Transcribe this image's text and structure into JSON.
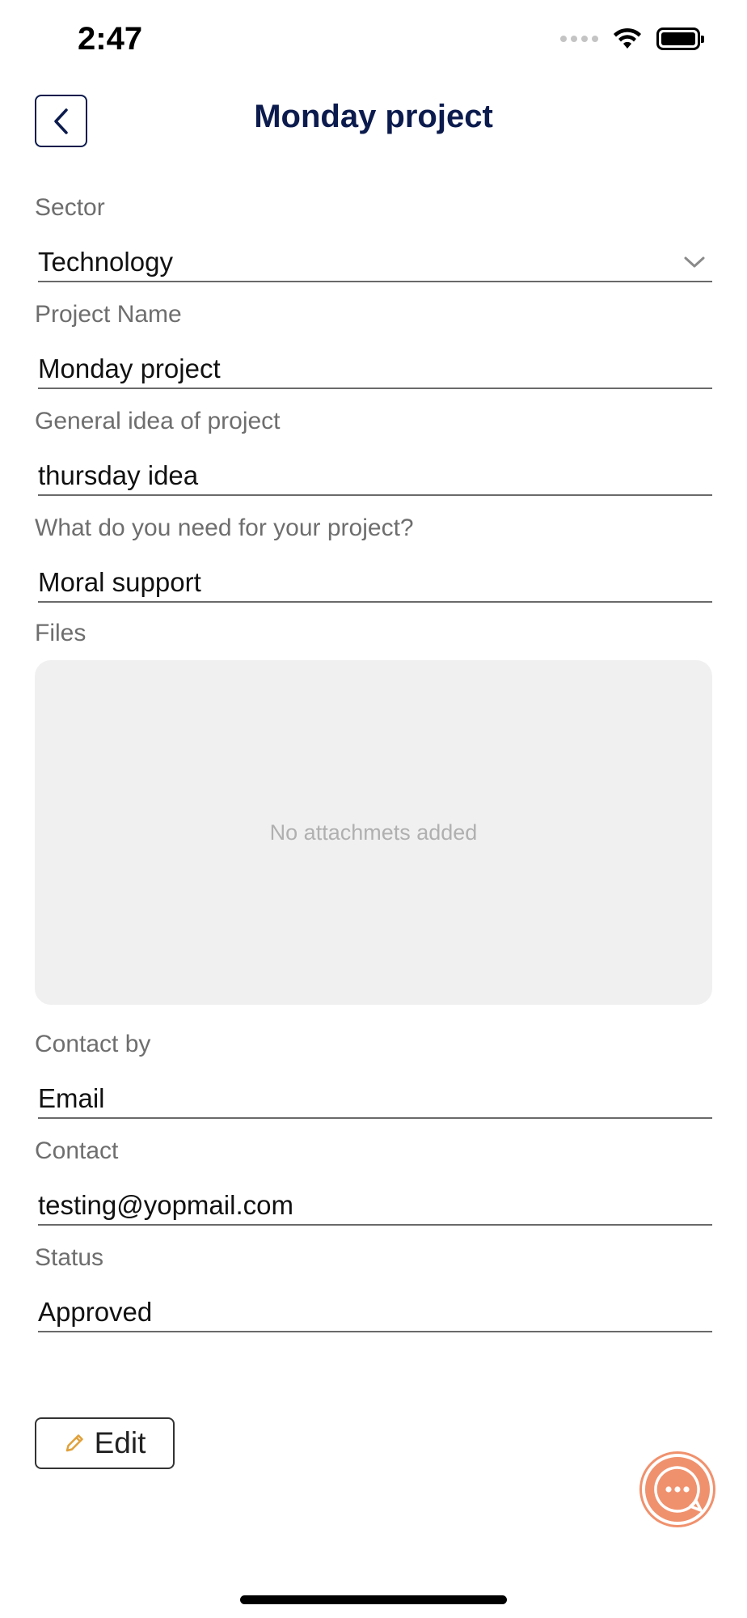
{
  "status_bar": {
    "time": "2:47"
  },
  "header": {
    "title": "Monday project"
  },
  "form": {
    "sector": {
      "label": "Sector",
      "value": "Technology"
    },
    "project_name": {
      "label": "Project Name",
      "value": "Monday project"
    },
    "general_idea": {
      "label": "General idea of project",
      "value": "thursday idea"
    },
    "needs": {
      "label": "What do you need for your project?",
      "value": "Moral support"
    },
    "files": {
      "label": "Files",
      "empty_text": "No attachmets added"
    },
    "contact_by": {
      "label": "Contact by",
      "value": "Email"
    },
    "contact": {
      "label": "Contact",
      "value": "testing@yopmail.com"
    },
    "status": {
      "label": "Status",
      "value": "Approved"
    }
  },
  "actions": {
    "edit_label": "Edit"
  },
  "colors": {
    "title": "#0c1b4d",
    "edit_icon": "#e0a13a",
    "chat_fab": "#f0916d",
    "files_bg": "#f0f0f0"
  },
  "icons": {
    "back": "chevron-left-icon",
    "dropdown": "chevron-down-icon",
    "edit": "pencil-icon",
    "chat": "chat-bubble-icon"
  }
}
